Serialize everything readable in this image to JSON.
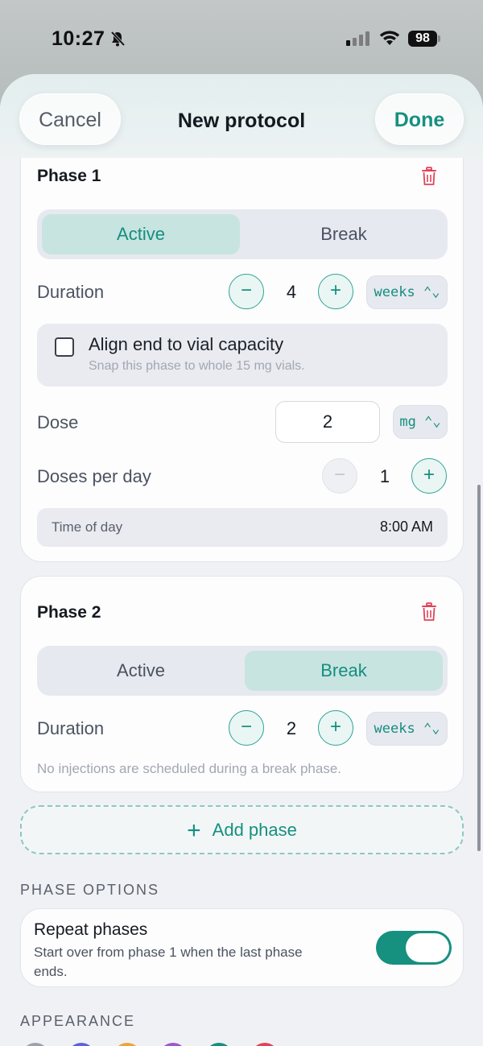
{
  "status_bar": {
    "time": "10:27",
    "battery": "98"
  },
  "header": {
    "cancel_label": "Cancel",
    "title": "New protocol",
    "done_label": "Done"
  },
  "phase1": {
    "title": "Phase 1",
    "segment": {
      "active_label": "Active",
      "break_label": "Break",
      "selected": "Active"
    },
    "duration": {
      "label": "Duration",
      "value": "4",
      "unit": "weeks ⌃⌄"
    },
    "align": {
      "title": "Align end to vial capacity",
      "subtitle": "Snap this phase to whole 15 mg vials.",
      "checked": false
    },
    "dose": {
      "label": "Dose",
      "value": "2",
      "unit": "mg ⌃⌄"
    },
    "doses_per_day": {
      "label": "Doses per day",
      "value": "1"
    },
    "time_of_day": {
      "label": "Time of day",
      "value": "8:00 AM"
    }
  },
  "phase2": {
    "title": "Phase 2",
    "segment": {
      "active_label": "Active",
      "break_label": "Break",
      "selected": "Break"
    },
    "duration": {
      "label": "Duration",
      "value": "2",
      "unit": "weeks ⌃⌄"
    },
    "hint": "No injections are scheduled during a break phase."
  },
  "add_phase_label": "Add phase",
  "phase_options": {
    "section_title": "PHASE OPTIONS",
    "repeat_title": "Repeat phases",
    "repeat_subtitle": "Start over from phase 1 when the last phase ends.",
    "repeat_on": true
  },
  "appearance": {
    "section_title": "APPEARANCE",
    "swatch_colors": [
      "#9aa3ad",
      "#5b63d6",
      "#e9a53a",
      "#9b59c9",
      "#178f7e",
      "#e0445a"
    ]
  },
  "colors": {
    "accent": "#16907f",
    "destructive": "#e0445a"
  }
}
